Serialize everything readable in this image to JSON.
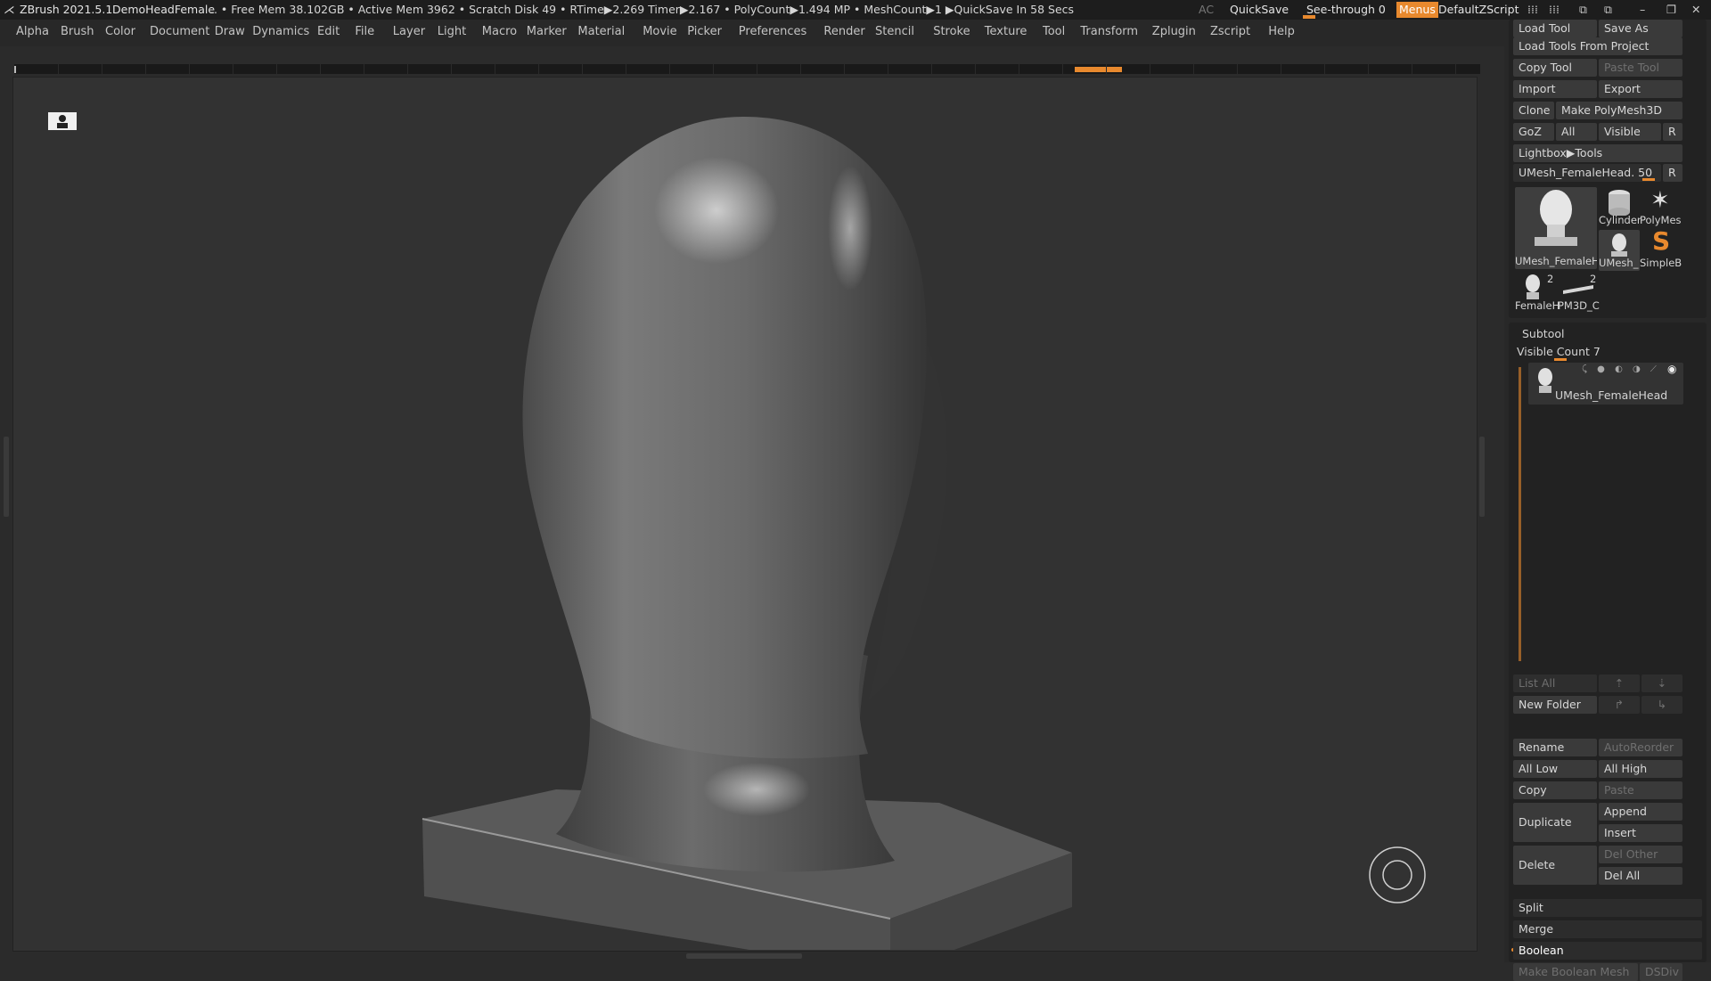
{
  "titlebar": {
    "app": "ZBrush 2021.5.1",
    "doc": "DemoHeadFemale",
    "stats": ".. • Free Mem 38.102GB • Active Mem 3962 • Scratch Disk 49 •  RTime▶2.269 Timer▶2.167 • PolyCount▶1.494 MP  • MeshCount▶1   ▶QuickSave In 58 Secs",
    "ac": "AC",
    "quicksave": "QuickSave",
    "see_through": "See-through  0",
    "menus": "Menus",
    "script": "DefaultZScript"
  },
  "menubar": {
    "items": [
      "Alpha",
      "Brush",
      "Color",
      "Document",
      "Draw",
      "Dynamics",
      "Edit",
      "File",
      "Layer",
      "Light",
      "Macro",
      "Marker",
      "Material",
      "Movie",
      "Picker",
      "Preferences",
      "Render",
      "Stencil",
      "Stroke",
      "Texture",
      "Tool",
      "Transform",
      "Zplugin",
      "Zscript",
      "Help"
    ]
  },
  "tool_panel": {
    "load_tool": "Load Tool",
    "save_as": "Save As",
    "load_tools_from_project": "Load Tools From Project",
    "copy_tool": "Copy Tool",
    "paste_tool": "Paste Tool",
    "import": "Import",
    "export": "Export",
    "clone": "Clone",
    "make_polymesh": "Make PolyMesh3D",
    "goz": "GoZ",
    "all": "All",
    "visible": "Visible",
    "r": "R",
    "lightbox_tools": "Lightbox▶Tools",
    "current_tool": "UMesh_FemaleHead. 50",
    "current_tool_r": "R",
    "thumbs": {
      "main": "UMesh_FemaleH",
      "cylinder": "Cylinder",
      "polymesh": "PolyMes",
      "umesh_small": "UMesh_",
      "simpleb": "SimpleB",
      "female": "FemaleH",
      "pm3d": "PM3D_C",
      "female_count": "2",
      "pm3d_count": "2"
    }
  },
  "subtool": {
    "title": "Subtool",
    "visible_count": "Visible Count 7",
    "item_name": "UMesh_FemaleHead",
    "list_all": "List All",
    "new_folder": "New Folder",
    "rename": "Rename",
    "autoreorder": "AutoReorder",
    "all_low": "All Low",
    "all_high": "All High",
    "copy": "Copy",
    "paste": "Paste",
    "duplicate": "Duplicate",
    "append": "Append",
    "insert": "Insert",
    "delete": "Delete",
    "del_other": "Del Other",
    "del_all": "Del All",
    "split": "Split",
    "merge": "Merge",
    "boolean": "Boolean",
    "make_boolean_mesh": "Make Boolean Mesh",
    "dsdiv": "DSDiv"
  },
  "colors": {
    "accent": "#e8892e",
    "panel": "#282828",
    "viewport": "#323232"
  }
}
